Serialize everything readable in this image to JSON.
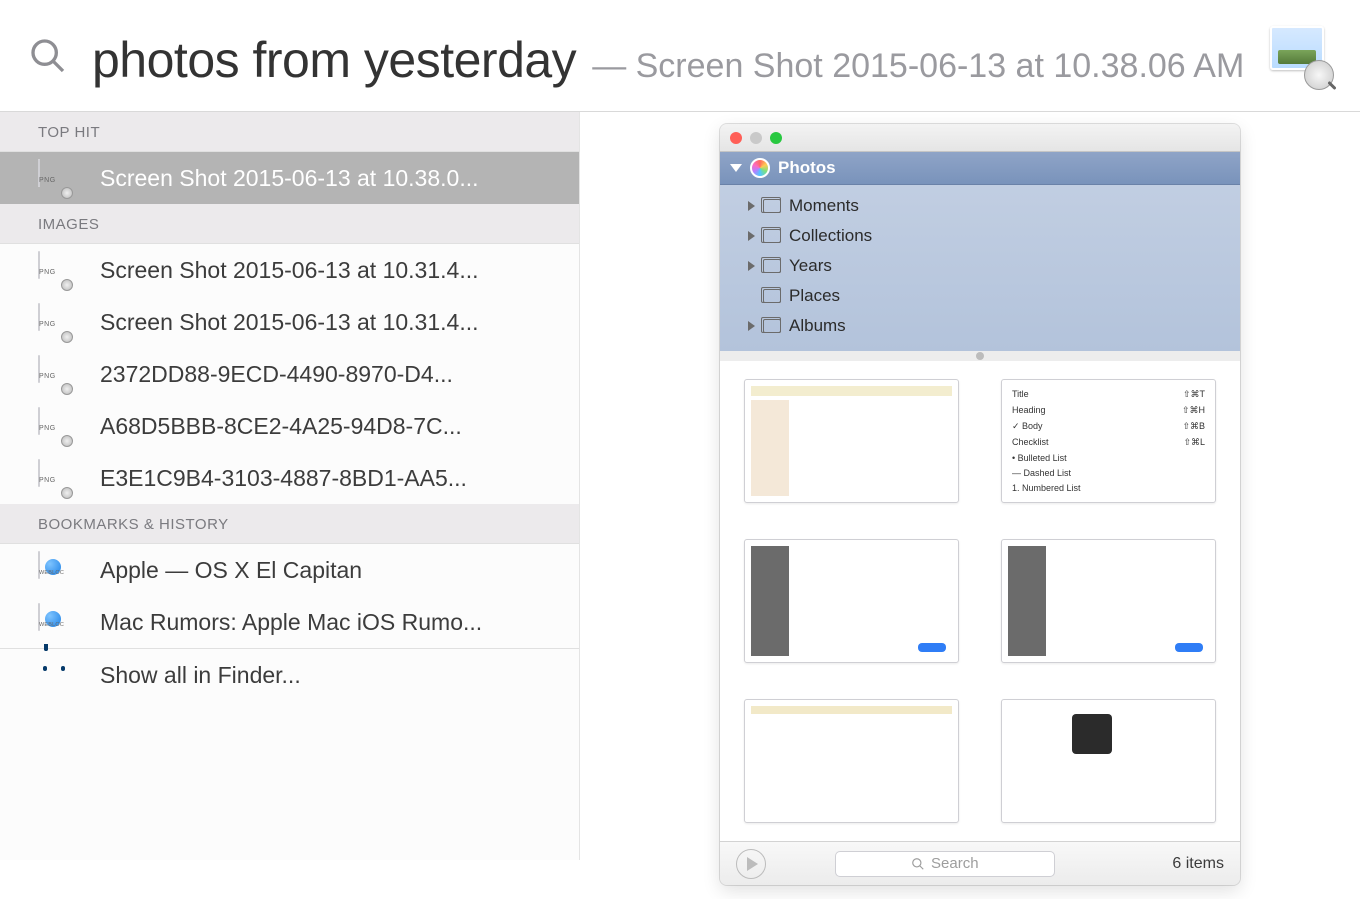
{
  "search": {
    "query": "photos from yesterday",
    "completion": "— Screen Shot 2015-06-13 at 10.38.06 AM"
  },
  "sections": {
    "top_hit": {
      "header": "TOP HIT",
      "items": [
        {
          "label": "Screen Shot 2015-06-13 at 10.38.0...",
          "icon": "png",
          "selected": true
        }
      ]
    },
    "images": {
      "header": "IMAGES",
      "items": [
        {
          "label": "Screen Shot 2015-06-13 at 10.31.4...",
          "icon": "png"
        },
        {
          "label": "Screen Shot 2015-06-13 at 10.31.4...",
          "icon": "png"
        },
        {
          "label": "2372DD88-9ECD-4490-8970-D4...",
          "icon": "png"
        },
        {
          "label": "A68D5BBB-8CE2-4A25-94D8-7C...",
          "icon": "png"
        },
        {
          "label": "E3E1C9B4-3103-4887-8BD1-AA5...",
          "icon": "png"
        }
      ]
    },
    "bookmarks": {
      "header": "BOOKMARKS & HISTORY",
      "items": [
        {
          "label": "Apple — OS X El Capitan",
          "icon": "webloc"
        },
        {
          "label": "Mac Rumors: Apple Mac iOS Rumo...",
          "icon": "webloc"
        }
      ]
    },
    "footer": {
      "label": "Show all in Finder..."
    }
  },
  "preview": {
    "app": "Photos",
    "sidebar": [
      {
        "label": "Moments",
        "expandable": true
      },
      {
        "label": "Collections",
        "expandable": true
      },
      {
        "label": "Years",
        "expandable": true
      },
      {
        "label": "Places",
        "expandable": false
      },
      {
        "label": "Albums",
        "expandable": true
      }
    ],
    "menu_thumb": [
      {
        "label": "Title",
        "shortcut": "⇧⌘T"
      },
      {
        "label": "Heading",
        "shortcut": "⇧⌘H"
      },
      {
        "label": "Body",
        "shortcut": "⇧⌘B",
        "checked": true
      },
      {
        "label": "Checklist",
        "shortcut": "⇧⌘L"
      },
      {
        "label": "• Bulleted List",
        "shortcut": ""
      },
      {
        "label": "— Dashed List",
        "shortcut": ""
      },
      {
        "label": "1. Numbered List",
        "shortcut": ""
      }
    ],
    "status": {
      "search_placeholder": "Search",
      "count": "6 items"
    }
  }
}
